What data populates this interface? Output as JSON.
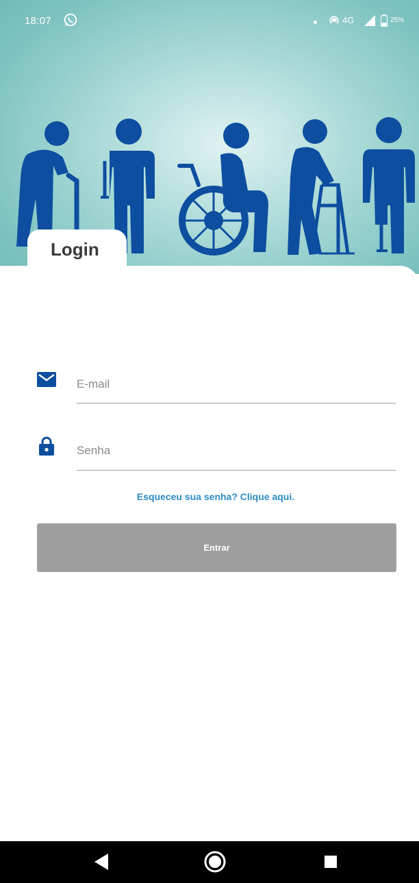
{
  "status_bar": {
    "time": "18:07",
    "network": "4G",
    "battery_percent": "25%",
    "icons": [
      "whatsapp-icon",
      "hotspot-icon",
      "signal-icon",
      "battery-icon"
    ]
  },
  "hero": {
    "illustration": [
      "elderly-with-cane-icon",
      "person-prosthetic-arm-icon",
      "wheelchair-user-icon",
      "elderly-with-walker-icon",
      "person-prosthetic-leg-icon"
    ],
    "figure_color": "#0d4ea0"
  },
  "login": {
    "tab_title": "Login",
    "email_placeholder": "E-mail",
    "email_value": "",
    "password_placeholder": "Senha",
    "password_value": "",
    "forgot_link": "Esqueceu sua senha? Clique aqui.",
    "submit_label": "Entrar"
  },
  "nav": {
    "back": "back-icon",
    "home": "home-icon",
    "recents": "recents-icon"
  },
  "colors": {
    "accent": "#0d4ea0",
    "link": "#2b8bc4",
    "button_disabled": "#9e9e9e"
  }
}
